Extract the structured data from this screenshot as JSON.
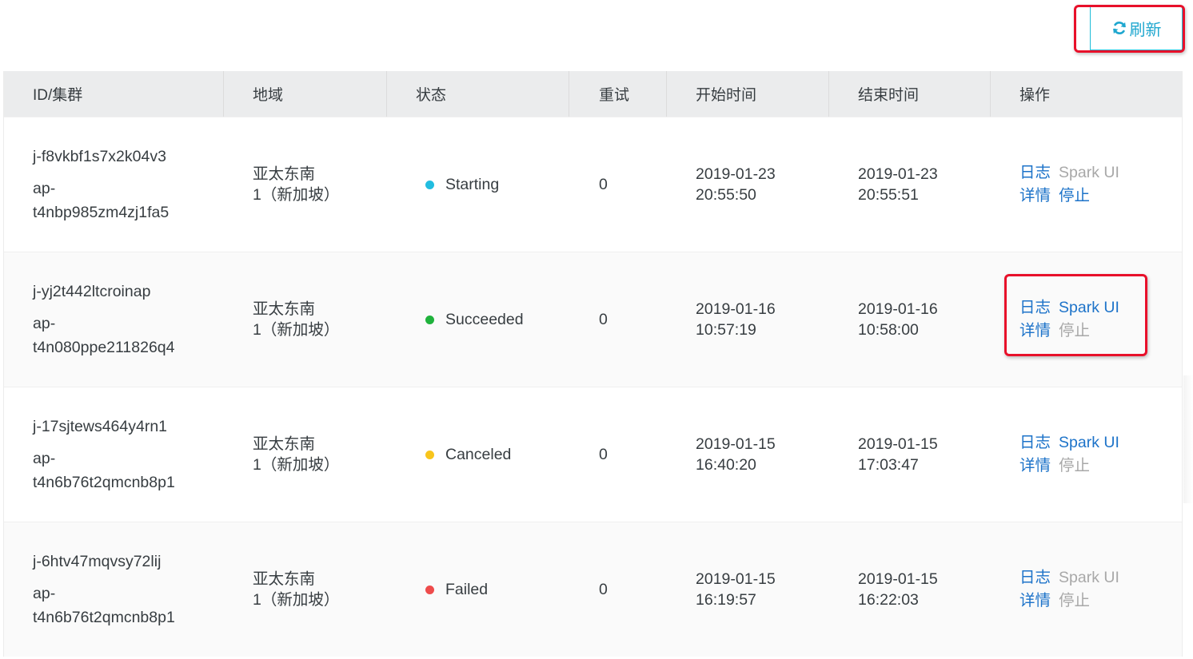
{
  "toolbar": {
    "refresh_label": "刷新",
    "refresh_icon": "refresh-icon",
    "accent_color": "#1fa7cf"
  },
  "table": {
    "headers": [
      "ID/集群",
      "地域",
      "状态",
      "重试",
      "开始时间",
      "结束时间",
      "操作"
    ],
    "rows": [
      {
        "job_id": "j-f8vkbf1s7x2k04v3",
        "cluster_id_line1": "ap-",
        "cluster_id_line2": "t4nbp985zm4zj1fa5",
        "region_line1": "亚太东南",
        "region_line2": "1（新加坡）",
        "status": "Starting",
        "status_color": "#22bde0",
        "retries": "0",
        "start_date": "2019-01-23",
        "start_time": "20:55:50",
        "end_date": "2019-01-23",
        "end_time": "20:55:51",
        "ops": {
          "log": "日志",
          "spark_ui": "Spark UI",
          "detail": "详情",
          "stop": "停止"
        },
        "ops_enabled": {
          "log": true,
          "spark_ui": false,
          "detail": true,
          "stop": true
        }
      },
      {
        "job_id": "j-yj2t442ltcroinap",
        "cluster_id_line1": "ap-",
        "cluster_id_line2": "t4n080ppe211826q4",
        "region_line1": "亚太东南",
        "region_line2": "1（新加坡）",
        "status": "Succeeded",
        "status_color": "#1fb23c",
        "retries": "0",
        "start_date": "2019-01-16",
        "start_time": "10:57:19",
        "end_date": "2019-01-16",
        "end_time": "10:58:00",
        "ops": {
          "log": "日志",
          "spark_ui": "Spark UI",
          "detail": "详情",
          "stop": "停止"
        },
        "ops_enabled": {
          "log": true,
          "spark_ui": true,
          "detail": true,
          "stop": false
        }
      },
      {
        "job_id": "j-17sjtews464y4rn1",
        "cluster_id_line1": "ap-",
        "cluster_id_line2": "t4n6b76t2qmcnb8p1",
        "region_line1": "亚太东南",
        "region_line2": "1（新加坡）",
        "status": "Canceled",
        "status_color": "#f8c51c",
        "retries": "0",
        "start_date": "2019-01-15",
        "start_time": "16:40:20",
        "end_date": "2019-01-15",
        "end_time": "17:03:47",
        "ops": {
          "log": "日志",
          "spark_ui": "Spark UI",
          "detail": "详情",
          "stop": "停止"
        },
        "ops_enabled": {
          "log": true,
          "spark_ui": true,
          "detail": true,
          "stop": false
        }
      },
      {
        "job_id": "j-6htv47mqvsy72lij",
        "cluster_id_line1": "ap-",
        "cluster_id_line2": "t4n6b76t2qmcnb8p1",
        "region_line1": "亚太东南",
        "region_line2": "1（新加坡）",
        "status": "Failed",
        "status_color": "#ee4b4b",
        "retries": "0",
        "start_date": "2019-01-15",
        "start_time": "16:19:57",
        "end_date": "2019-01-15",
        "end_time": "16:22:03",
        "ops": {
          "log": "日志",
          "spark_ui": "Spark UI",
          "detail": "详情",
          "stop": "停止"
        },
        "ops_enabled": {
          "log": true,
          "spark_ui": false,
          "detail": true,
          "stop": false
        }
      }
    ]
  },
  "annotations": {
    "highlight_color": "#e8102a"
  }
}
